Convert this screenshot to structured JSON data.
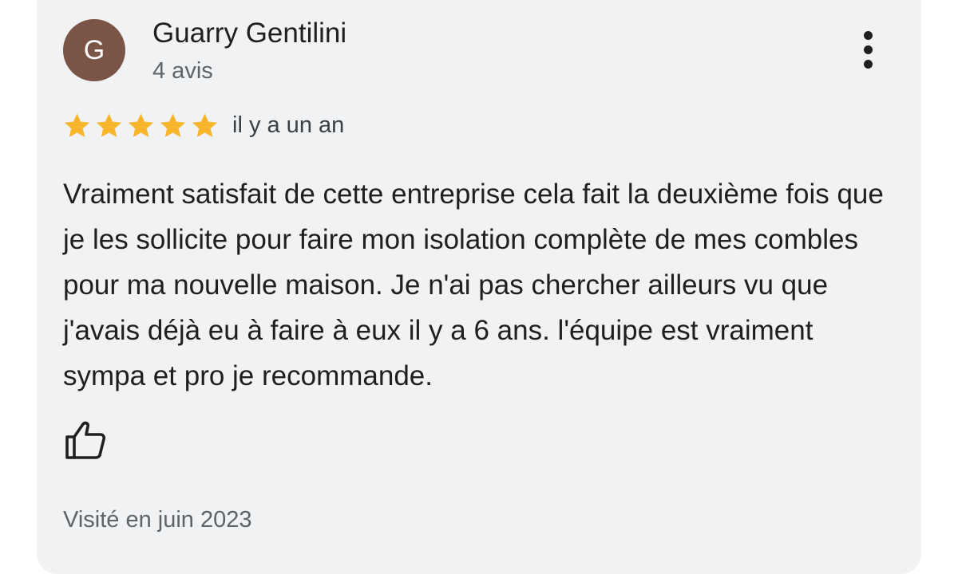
{
  "review": {
    "author": {
      "initial": "G",
      "name": "Guarry Gentilini",
      "review_count": "4 avis",
      "avatar_color": "#7a5547"
    },
    "more_menu_icon": "more-vertical-icon",
    "rating": {
      "value": 5,
      "max": 5,
      "star_color": "#f7b52c"
    },
    "time_ago": "il y a un an",
    "text": "Vraiment satisfait de cette entreprise cela fait la deuxième fois que je les sollicite pour faire mon isolation complète de mes combles pour ma nouvelle maison. Je n'ai pas chercher ailleurs vu que j'avais déjà eu à faire à eux il y a 6 ans. l'équipe est vraiment sympa et pro je recommande.",
    "like_icon": "thumbs-up-icon",
    "visited": "Visité en juin 2023"
  }
}
